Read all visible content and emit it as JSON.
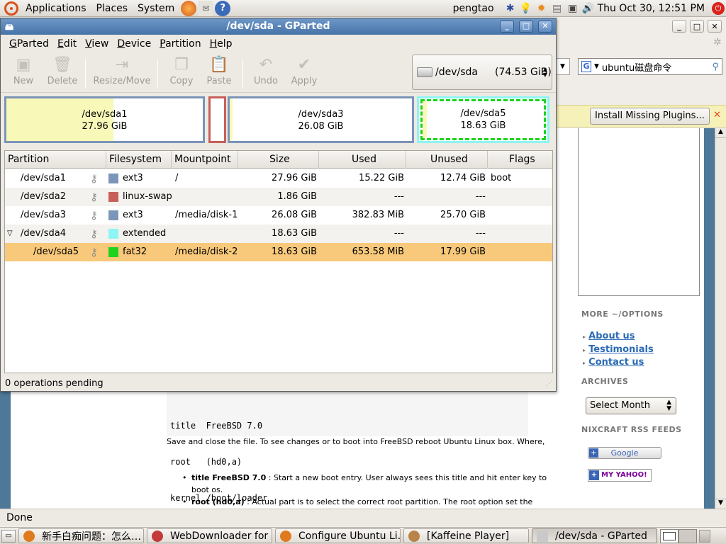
{
  "top_panel": {
    "menus": [
      "Applications",
      "Places",
      "System"
    ],
    "user": "pengtao",
    "clock": "Thu Oct 30, 12:51 PM"
  },
  "browser": {
    "search_value": "ubuntu磁盘命令",
    "install_plugins": "Install Missing Plugins...",
    "status": "Done",
    "sidebar": {
      "options_title": "MORE ~/OPTIONS",
      "links": [
        "About us",
        "Testimonials",
        "Contact us"
      ],
      "archives_title": "ARCHIVES",
      "archives_select": "Select Month",
      "rss_title": "NIXCRAFT RSS FEEDS",
      "google_label": "Google",
      "yahoo_label": "MY YAHOO!"
    },
    "article": {
      "code": [
        "title  FreeBSD 7.0",
        "root   (hd0,a)",
        "kernel /boot/loader"
      ],
      "paragraph": "Save and close the file. To see changes or to boot into FreeBSD reboot Ubuntu Linux box. Where,",
      "bullets": [
        {
          "bold": "title FreeBSD 7.0",
          "text": " : Start a new boot entry. User always sees this title and hit enter key to boot os."
        },
        {
          "bold": "root (hd0,a)",
          "text": " : Actual part is to select the correct root partition. The root option set the"
        }
      ]
    }
  },
  "gparted": {
    "title": "/dev/sda - GParted",
    "menu": [
      {
        "u": "G",
        "rest": "Parted"
      },
      {
        "u": "E",
        "rest": "dit"
      },
      {
        "u": "V",
        "rest": "iew"
      },
      {
        "u": "D",
        "rest": "evice"
      },
      {
        "u": "P",
        "rest": "artition"
      },
      {
        "u": "H",
        "rest": "elp"
      }
    ],
    "toolbar": [
      "New",
      "Delete",
      "Resize/Move",
      "Copy",
      "Paste",
      "Undo",
      "Apply"
    ],
    "device": {
      "name": "/dev/sda",
      "size": "(74.53 GiB)"
    },
    "graph": [
      {
        "name": "/dev/sda1",
        "size": "27.96 GiB",
        "used_fraction": 0.545
      },
      {
        "name": "/dev/sda3",
        "size": "26.08 GiB",
        "used_fraction": 0.015
      },
      {
        "name": "/dev/sda5",
        "size": "18.63 GiB",
        "used_fraction": 0.035
      }
    ],
    "columns": [
      "Partition",
      "Filesystem",
      "Mountpoint",
      "Size",
      "Used",
      "Unused",
      "Flags"
    ],
    "rows": [
      {
        "partition": "/dev/sda1",
        "filesystem": "ext3",
        "color": "#7b96b8",
        "mountpoint": "/",
        "size": "27.96 GiB",
        "used": "15.22 GiB",
        "unused": "12.74 GiB",
        "flags": "boot"
      },
      {
        "partition": "/dev/sda2",
        "filesystem": "linux-swap",
        "color": "#c8605a",
        "mountpoint": "",
        "size": "1.86 GiB",
        "used": "---",
        "unused": "---",
        "flags": ""
      },
      {
        "partition": "/dev/sda3",
        "filesystem": "ext3",
        "color": "#7b96b8",
        "mountpoint": "/media/disk-1",
        "size": "26.08 GiB",
        "used": "382.83 MiB",
        "unused": "25.70 GiB",
        "flags": ""
      },
      {
        "partition": "/dev/sda4",
        "filesystem": "extended",
        "color": "#8ef4f4",
        "mountpoint": "",
        "size": "18.63 GiB",
        "used": "---",
        "unused": "---",
        "flags": ""
      },
      {
        "partition": "/dev/sda5",
        "filesystem": "fat32",
        "color": "#1ed21e",
        "mountpoint": "/media/disk-2",
        "size": "18.63 GiB",
        "used": "653.58 MiB",
        "unused": "17.99 GiB",
        "flags": ""
      }
    ],
    "status": "0 operations pending"
  },
  "taskbar": [
    {
      "label": "新手白痴问题：怎么…",
      "icon": "firefox-icon",
      "color": "#e07a1f"
    },
    {
      "label": "WebDownloader for …",
      "icon": "webdownloader-icon",
      "color": "#c43a3a"
    },
    {
      "label": "Configure Ubuntu Li…",
      "icon": "firefox-icon",
      "color": "#e07a1f"
    },
    {
      "label": "[Kaffeine Player]",
      "icon": "kaffeine-icon",
      "color": "#b8844a"
    },
    {
      "label": "/dev/sda - GParted",
      "icon": "gparted-icon",
      "color": "#c9c9c9"
    }
  ]
}
